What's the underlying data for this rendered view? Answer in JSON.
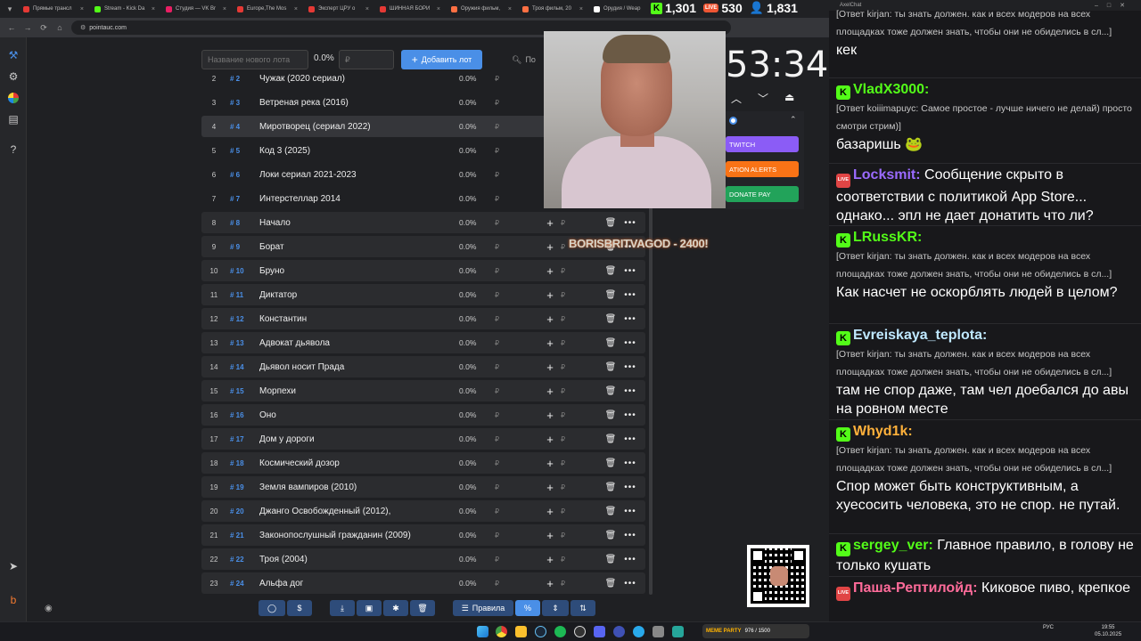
{
  "browser": {
    "tabs": [
      {
        "label": "Прямые трансл",
        "color": "#e53935"
      },
      {
        "label": "Stream - Kick Da",
        "color": "#53fc18"
      },
      {
        "label": "Студия — VK Br",
        "color": "#e91e63"
      },
      {
        "label": "Europe,The Mos",
        "color": "#e53935"
      },
      {
        "label": "Эксперт ЦРУ о",
        "color": "#e53935"
      },
      {
        "label": "ШИННАЯ БОРИ",
        "color": "#e53935"
      },
      {
        "label": "Оружия фильм,",
        "color": "#ff7043"
      },
      {
        "label": "Троя фильм, 20",
        "color": "#ff7043"
      },
      {
        "label": "Орудия / Weap",
        "color": "#fff"
      }
    ],
    "url": "pointauc.com"
  },
  "stream_counters": {
    "kick": "1,301",
    "vk": "530",
    "viewers": "1,831"
  },
  "toolbar_top": {
    "new_lot_placeholder": "Название нового лота",
    "percent": "0.0%",
    "rub_placeholder": "₽",
    "add_button": "Добавить лот",
    "search_label": "По"
  },
  "lots": [
    {
      "num": "2",
      "id": "# 2",
      "name": "Чужак (2020 сериал)",
      "pct": "0.0%"
    },
    {
      "num": "3",
      "id": "# 3",
      "name": "Ветреная река (2016)",
      "pct": "0.0%"
    },
    {
      "num": "4",
      "id": "# 4",
      "name": "Миротворец (сериал 2022)",
      "pct": "0.0%"
    },
    {
      "num": "5",
      "id": "# 5",
      "name": "Код 3 (2025)",
      "pct": "0.0%"
    },
    {
      "num": "6",
      "id": "# 6",
      "name": "Локи сериал 2021-2023",
      "pct": "0.0%"
    },
    {
      "num": "7",
      "id": "# 7",
      "name": "Интерстеллар 2014",
      "pct": "0.0%"
    },
    {
      "num": "8",
      "id": "# 8",
      "name": "Начало",
      "pct": "0.0%"
    },
    {
      "num": "9",
      "id": "# 9",
      "name": "Борат",
      "pct": "0.0%"
    },
    {
      "num": "10",
      "id": "# 10",
      "name": "Бруно",
      "pct": "0.0%"
    },
    {
      "num": "11",
      "id": "# 11",
      "name": "Диктатор",
      "pct": "0.0%"
    },
    {
      "num": "12",
      "id": "# 12",
      "name": "Константин",
      "pct": "0.0%"
    },
    {
      "num": "13",
      "id": "# 13",
      "name": "Адвокат дьявола",
      "pct": "0.0%"
    },
    {
      "num": "14",
      "id": "# 14",
      "name": "Дьявол носит Прада",
      "pct": "0.0%"
    },
    {
      "num": "15",
      "id": "# 15",
      "name": "Морпехи",
      "pct": "0.0%"
    },
    {
      "num": "16",
      "id": "# 16",
      "name": "Оно",
      "pct": "0.0%"
    },
    {
      "num": "17",
      "id": "# 17",
      "name": "Дом у дороги",
      "pct": "0.0%"
    },
    {
      "num": "18",
      "id": "# 18",
      "name": "Космический дозор",
      "pct": "0.0%"
    },
    {
      "num": "19",
      "id": "# 19",
      "name": "Земля вампиров (2010)",
      "pct": "0.0%"
    },
    {
      "num": "20",
      "id": "# 20",
      "name": "Джанго Освобожденный (2012),",
      "pct": "0.0%"
    },
    {
      "num": "21",
      "id": "# 21",
      "name": "Законопослушный гражданин (2009)",
      "pct": "0.0%"
    },
    {
      "num": "22",
      "id": "# 22",
      "name": "Троя (2004)",
      "pct": "0.0%"
    },
    {
      "num": "23",
      "id": "# 24",
      "name": "Альфа дог",
      "pct": "0.0%"
    }
  ],
  "rub_symbol": "₽",
  "bottom_toolbar": {
    "rules_label": "Правила",
    "percent_icon": "%"
  },
  "overlay": {
    "timer": "53:34",
    "buttons": {
      "twitch": "TWITCH",
      "alerts": "ATION ALERTS",
      "donatepay": "DONATE PAY"
    },
    "donation": "BORISBRITVAGOD - 2400!"
  },
  "chat": {
    "title": "AxelChat",
    "messages": [
      {
        "reply": "[Ответ kirjan: ты знать должен. как и всех модеров на всех площадках тоже должен знать, чтобы они не обиделись в сл...]",
        "text": "кек"
      },
      {
        "user": "VladX3000:",
        "user_color": "#53fc18",
        "platform": "kick",
        "reply": "[Ответ koiiimapuyc: Самое простое - лучше ничего не делай) просто смотри стрим)]",
        "text": "базаришь 🐸"
      },
      {
        "user": "Locksmit:",
        "user_color": "#9b6bff",
        "platform": "vk",
        "text": "Сообщение скрыто в соответствии с политикой App Store... однако... эпл не дает донатить что ли?"
      },
      {
        "user": "LRussKR:",
        "user_color": "#53fc18",
        "platform": "kick",
        "reply": "[Ответ kirjan: ты знать должен. как и всех модеров на всех площадках тоже должен знать, чтобы они не обиделись в сл...]",
        "text": "Как насчет не оскорблять людей в целом?"
      },
      {
        "user": "Evreiskaya_teplota:",
        "user_color": "#bfe8ff",
        "platform": "kick",
        "reply": "[Ответ kirjan: ты знать должен. как и всех модеров на всех площадках тоже должен знать, чтобы они не обиделись в сл...]",
        "text": "там не спор даже, там чел доебался до авы на ровном месте"
      },
      {
        "user": "Whyd1k:",
        "user_color": "#ffb13b",
        "platform": "kick",
        "reply": "[Ответ kirjan: ты знать должен. как и всех модеров на всех площадках тоже должен знать, чтобы они не обиделись в сл...]",
        "text": "Спор может быть конструктивным, а хуесосить человека, это не спор. не путай."
      },
      {
        "user": "sergey_ver:",
        "user_color": "#53fc18",
        "platform": "kick",
        "text": "Главное правило, в голову не только кушать"
      },
      {
        "user": "Паша-Рептилойд:",
        "user_color": "#ff6b9a",
        "platform": "vk",
        "text": "Киковое пиво, крепкое"
      }
    ]
  },
  "taskbar": {
    "meme_label": "MEME PARTY",
    "meme_count": "976 / 1500",
    "lang": "РУС",
    "time": "19:55",
    "date": "05.10.2025"
  },
  "colors": {
    "accent": "#4a8fe7",
    "kick": "#53fc18",
    "twitch": "#8b5cf6",
    "alerts": "#f97316",
    "donatepay": "#22a35a"
  }
}
